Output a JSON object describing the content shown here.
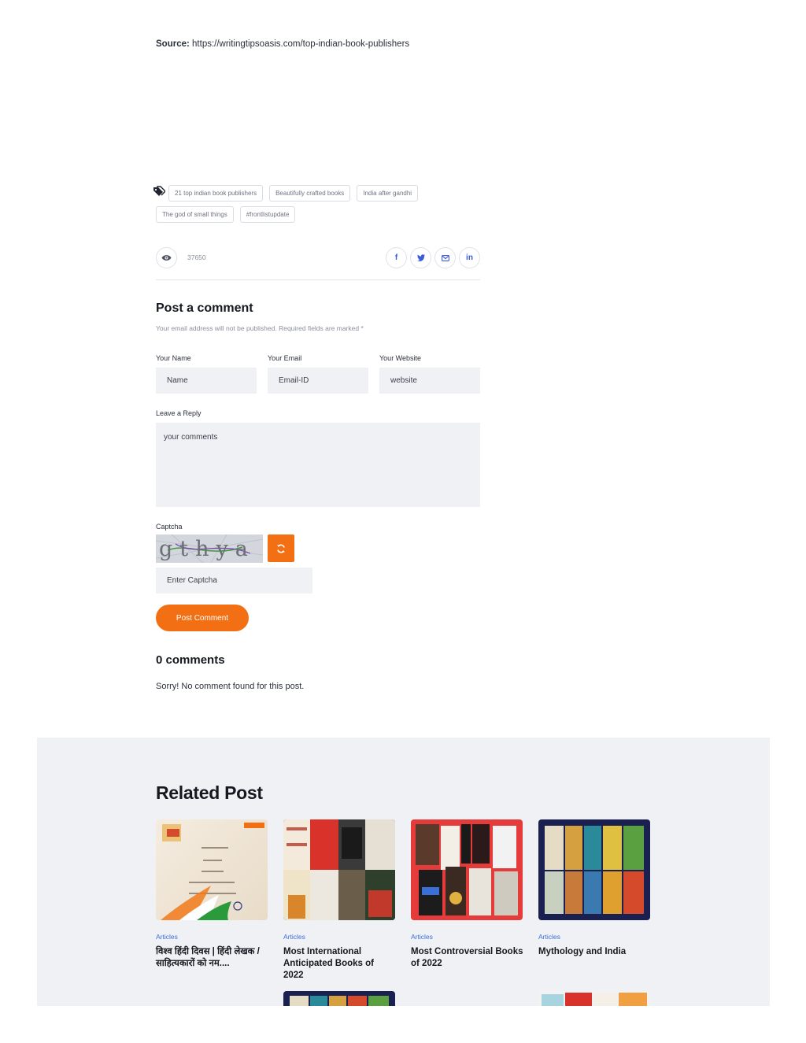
{
  "source": {
    "label": "Source:",
    "url": "https://writingtipsoasis.com/top-indian-book-publishers"
  },
  "tags": [
    "21 top indian book publishers",
    "Beautifully crafted books",
    "India after gandhi",
    "The god of small things",
    "#frontlistupdate"
  ],
  "views": "37650",
  "share": {
    "facebook": "f",
    "linkedin": "in"
  },
  "comment_form": {
    "title": "Post a comment",
    "note": "Your email address will not be published. Required fields are marked *",
    "name_label": "Your Name",
    "name_placeholder": "Name",
    "email_label": "Your Email",
    "email_placeholder": "Email-ID",
    "website_label": "Your Website",
    "website_placeholder": "website",
    "reply_label": "Leave a Reply",
    "reply_placeholder": "your comments",
    "captcha_label": "Captcha",
    "captcha_text": "gthya",
    "captcha_placeholder": "Enter Captcha",
    "submit_label": "Post Comment"
  },
  "comments": {
    "title": "0 comments",
    "empty_text": "Sorry! No comment found for this post."
  },
  "related": {
    "title": "Related Post",
    "posts": [
      {
        "category": "Articles",
        "title": "विश्व हिंदी दिवस | हिंदी लेखक / साहित्यकारों को नम...."
      },
      {
        "category": "Articles",
        "title": "Most International Anticipated Books of 2022"
      },
      {
        "category": "Articles",
        "title": "Most Controversial Books of 2022"
      },
      {
        "category": "Articles",
        "title": "Mythology and India"
      }
    ]
  },
  "colors": {
    "accent": "#f36f13",
    "link": "#3b6fd8",
    "panel": "#eff1f5"
  }
}
